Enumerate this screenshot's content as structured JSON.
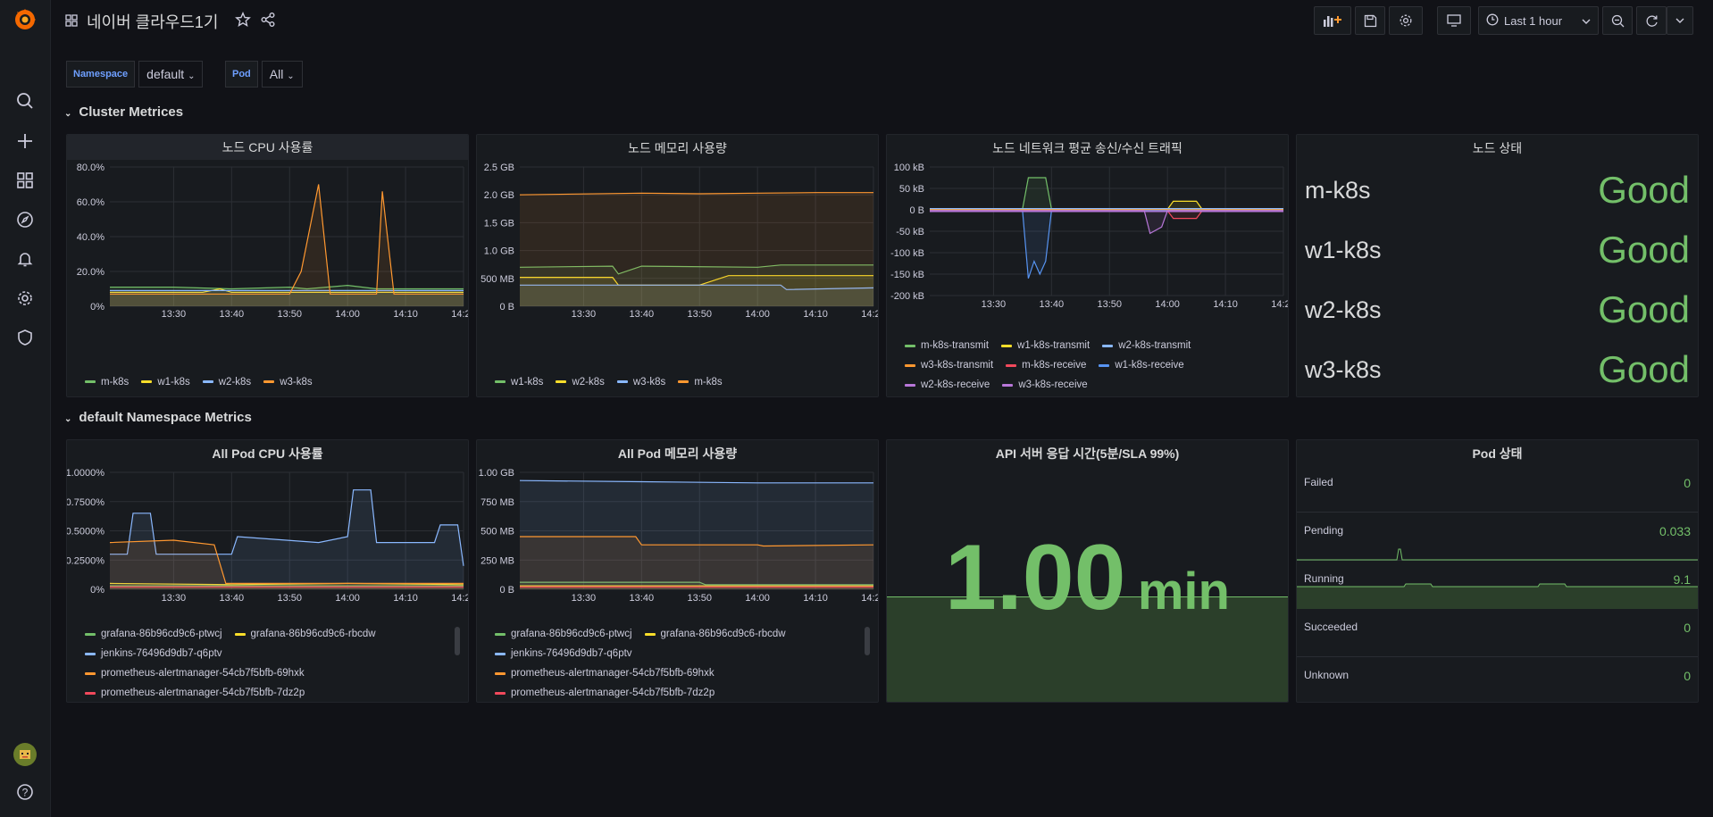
{
  "dashboard": {
    "title": "네이버 클라우드1기"
  },
  "toolbar": {
    "time_range": "Last 1 hour"
  },
  "variables": [
    {
      "label": "Namespace",
      "value": "default"
    },
    {
      "label": "Pod",
      "value": "All"
    }
  ],
  "rows": {
    "cluster": "Cluster Metrices",
    "namespace": "default Namespace Metrics"
  },
  "panels": {
    "node_cpu": {
      "title": "노드 CPU 사용률",
      "legend": [
        "m-k8s",
        "w1-k8s",
        "w2-k8s",
        "w3-k8s"
      ]
    },
    "node_mem": {
      "title": "노드 메모리 사용량",
      "legend": [
        "w1-k8s",
        "w2-k8s",
        "w3-k8s",
        "m-k8s"
      ]
    },
    "node_net": {
      "title": "노드 네트워크 평균 송신/수신 트래픽",
      "legend": [
        "m-k8s-transmit",
        "w1-k8s-transmit",
        "w2-k8s-transmit",
        "w3-k8s-transmit",
        "m-k8s-receive",
        "w1-k8s-receive",
        "w2-k8s-receive",
        "w3-k8s-receive"
      ]
    },
    "node_status": {
      "title": "노드 상태",
      "items": [
        {
          "name": "m-k8s",
          "value": "Good"
        },
        {
          "name": "w1-k8s",
          "value": "Good"
        },
        {
          "name": "w2-k8s",
          "value": "Good"
        },
        {
          "name": "w3-k8s",
          "value": "Good"
        }
      ]
    },
    "pod_cpu": {
      "title": "All Pod CPU 사용률",
      "legend": [
        "grafana-86b96cd9c6-ptwcj",
        "grafana-86b96cd9c6-rbcdw",
        "jenkins-76496d9db7-q6ptv",
        "prometheus-alertmanager-54cb7f5bfb-69hxk",
        "prometheus-alertmanager-54cb7f5bfb-7dz2p"
      ]
    },
    "pod_mem": {
      "title": "All Pod 메모리 사용량",
      "legend": [
        "grafana-86b96cd9c6-ptwcj",
        "grafana-86b96cd9c6-rbcdw",
        "jenkins-76496d9db7-q6ptv",
        "prometheus-alertmanager-54cb7f5bfb-69hxk",
        "prometheus-alertmanager-54cb7f5bfb-7dz2p"
      ]
    },
    "api_resp": {
      "title": "API 서버 응답 시간(5분/SLA 99%)",
      "value": "1.00",
      "unit": "min"
    },
    "pod_status": {
      "title": "Pod 상태",
      "items": [
        {
          "name": "Failed",
          "value": "0"
        },
        {
          "name": "Pending",
          "value": "0.033"
        },
        {
          "name": "Running",
          "value": "9.1"
        },
        {
          "name": "Succeeded",
          "value": "0"
        },
        {
          "name": "Unknown",
          "value": "0"
        }
      ]
    }
  },
  "colors": {
    "green": "#73bf69",
    "yellow": "#fade2a",
    "blue": "#5794f2",
    "orange": "#ff9830",
    "red": "#f2495c",
    "purple": "#b877d9",
    "cyan": "#8ab8ff",
    "teal": "#6ed0e0",
    "lightorange": "#ef843c",
    "pink": "#e24d42"
  },
  "chart_data": [
    {
      "type": "line",
      "panel": "node_cpu",
      "x_ticks": [
        "13:30",
        "13:40",
        "13:50",
        "14:00",
        "14:10",
        "14:20"
      ],
      "y_ticks": [
        "0%",
        "20.0%",
        "40.0%",
        "60.0%",
        "80.0%"
      ],
      "ylim": [
        0,
        80
      ],
      "series": [
        {
          "name": "m-k8s",
          "x": [
            "13:19",
            "13:30",
            "13:40",
            "13:50",
            "13:53",
            "14:00",
            "14:05",
            "14:08",
            "14:20"
          ],
          "y": [
            11,
            11,
            10,
            11,
            10,
            12,
            10,
            10,
            10
          ]
        },
        {
          "name": "w1-k8s",
          "x": [
            "13:19",
            "13:35",
            "13:38",
            "13:40",
            "13:50",
            "14:00",
            "14:10",
            "14:20"
          ],
          "y": [
            8,
            8,
            10,
            8,
            8,
            8,
            8,
            8
          ]
        },
        {
          "name": "w2-k8s",
          "x": [
            "13:19",
            "13:40",
            "13:50",
            "14:00",
            "14:10",
            "14:20"
          ],
          "y": [
            9,
            9,
            9,
            9,
            9,
            9
          ]
        },
        {
          "name": "w3-k8s",
          "x": [
            "13:19",
            "13:50",
            "13:52",
            "13:55",
            "13:57",
            "14:05",
            "14:06",
            "14:08",
            "14:20"
          ],
          "y": [
            7,
            7,
            20,
            70,
            7,
            7,
            66,
            7,
            7
          ]
        }
      ]
    },
    {
      "type": "line",
      "panel": "node_mem",
      "x_ticks": [
        "13:30",
        "13:40",
        "13:50",
        "14:00",
        "14:10",
        "14:20"
      ],
      "y_ticks": [
        "0 B",
        "500 MB",
        "1.0 GB",
        "1.5 GB",
        "2.0 GB",
        "2.5 GB"
      ],
      "ylim": [
        0,
        2.5
      ],
      "series": [
        {
          "name": "w1-k8s",
          "x": [
            "13:19",
            "13:35",
            "13:36",
            "13:40",
            "14:00",
            "14:04",
            "14:20"
          ],
          "y": [
            0.7,
            0.72,
            0.58,
            0.72,
            0.7,
            0.74,
            0.74
          ]
        },
        {
          "name": "w2-k8s",
          "x": [
            "13:19",
            "13:35",
            "13:36",
            "13:50",
            "13:55",
            "14:20"
          ],
          "y": [
            0.52,
            0.52,
            0.38,
            0.38,
            0.55,
            0.55
          ]
        },
        {
          "name": "w3-k8s",
          "x": [
            "13:19",
            "13:40",
            "14:04",
            "14:05",
            "14:20"
          ],
          "y": [
            0.38,
            0.38,
            0.38,
            0.3,
            0.33
          ]
        },
        {
          "name": "m-k8s",
          "x": [
            "13:19",
            "13:40",
            "13:50",
            "14:00",
            "14:10",
            "14:20"
          ],
          "y": [
            2.0,
            2.03,
            2.02,
            2.03,
            2.04,
            2.04
          ]
        }
      ]
    },
    {
      "type": "line",
      "panel": "node_net",
      "x_ticks": [
        "13:30",
        "13:40",
        "13:50",
        "14:00",
        "14:10",
        "14:20"
      ],
      "y_ticks": [
        "-200 kB",
        "-150 kB",
        "-100 kB",
        "-50 kB",
        "0 B",
        "50 kB",
        "100 kB"
      ],
      "ylim": [
        -200,
        100
      ],
      "series": [
        {
          "name": "m-k8s-transmit",
          "x": [
            "13:19",
            "13:35",
            "13:36",
            "13:39",
            "13:40",
            "14:20"
          ],
          "y": [
            2,
            2,
            75,
            75,
            2,
            2
          ]
        },
        {
          "name": "w1-k8s-transmit",
          "x": [
            "13:19",
            "14:00",
            "14:01",
            "14:05",
            "14:06",
            "14:20"
          ],
          "y": [
            1,
            1,
            20,
            20,
            1,
            1
          ]
        },
        {
          "name": "w2-k8s-transmit",
          "x": [
            "13:19",
            "14:20"
          ],
          "y": [
            3,
            3
          ]
        },
        {
          "name": "w3-k8s-transmit",
          "x": [
            "13:19",
            "14:20"
          ],
          "y": [
            0,
            0
          ]
        },
        {
          "name": "m-k8s-receive",
          "x": [
            "13:19",
            "13:36",
            "13:40",
            "14:00",
            "14:01",
            "14:05",
            "14:06",
            "14:20"
          ],
          "y": [
            -2,
            -2,
            -2,
            -2,
            -20,
            -20,
            -2,
            -2
          ]
        },
        {
          "name": "w1-k8s-receive",
          "x": [
            "13:19",
            "13:35",
            "13:36",
            "13:37",
            "13:38",
            "13:39",
            "13:40",
            "14:20"
          ],
          "y": [
            -2,
            -2,
            -160,
            -120,
            -150,
            -120,
            -2,
            -2
          ]
        },
        {
          "name": "w2-k8s-receive",
          "x": [
            "13:19",
            "13:56",
            "13:57",
            "13:59",
            "14:00",
            "14:20"
          ],
          "y": [
            -2,
            -2,
            -55,
            -40,
            -2,
            -2
          ]
        },
        {
          "name": "w3-k8s-receive",
          "x": [
            "13:19",
            "14:20"
          ],
          "y": [
            -4,
            -4
          ]
        }
      ]
    },
    {
      "type": "line",
      "panel": "pod_cpu",
      "x_ticks": [
        "13:30",
        "13:40",
        "13:50",
        "14:00",
        "14:10",
        "14:20"
      ],
      "y_ticks": [
        "0%",
        "0.2500%",
        "0.5000%",
        "0.7500%",
        "1.0000%"
      ],
      "ylim": [
        0,
        1.0
      ],
      "series": [
        {
          "name": "grafana-86b96cd9c6-ptwcj",
          "x": [
            "13:19",
            "13:40",
            "14:00",
            "14:20"
          ],
          "y": [
            0.03,
            0.03,
            0.03,
            0.03
          ]
        },
        {
          "name": "grafana-86b96cd9c6-rbcdw",
          "x": [
            "13:19",
            "13:40",
            "14:00",
            "14:20"
          ],
          "y": [
            0.05,
            0.04,
            0.05,
            0.04
          ]
        },
        {
          "name": "jenkins-76496d9db7-q6ptv",
          "x": [
            "13:19",
            "13:22",
            "13:23",
            "13:26",
            "13:27",
            "13:40",
            "13:41",
            "13:55",
            "14:00",
            "14:01",
            "14:04",
            "14:05",
            "14:15",
            "14:16",
            "14:19",
            "14:20"
          ],
          "y": [
            0.3,
            0.3,
            0.65,
            0.65,
            0.3,
            0.3,
            0.45,
            0.4,
            0.45,
            0.85,
            0.85,
            0.4,
            0.4,
            0.55,
            0.55,
            0.2
          ]
        },
        {
          "name": "prometheus-alertmanager-54cb7f5bfb-69hxk",
          "x": [
            "13:19",
            "13:30",
            "13:37",
            "13:39",
            "14:20"
          ],
          "y": [
            0.4,
            0.42,
            0.38,
            0.05,
            0.05
          ]
        },
        {
          "name": "prometheus-alertmanager-54cb7f5bfb-7dz2p",
          "x": [
            "13:19",
            "14:20"
          ],
          "y": [
            0.02,
            0.02
          ]
        }
      ]
    },
    {
      "type": "line",
      "panel": "pod_mem",
      "x_ticks": [
        "13:30",
        "13:40",
        "13:50",
        "14:00",
        "14:10",
        "14:20"
      ],
      "y_ticks": [
        "0 B",
        "250 MB",
        "500 MB",
        "750 MB",
        "1.00 GB"
      ],
      "ylim": [
        0,
        1000
      ],
      "series": [
        {
          "name": "grafana-86b96cd9c6-ptwcj",
          "x": [
            "13:19",
            "13:50",
            "13:51",
            "14:20"
          ],
          "y": [
            60,
            60,
            40,
            40
          ]
        },
        {
          "name": "grafana-86b96cd9c6-rbcdw",
          "x": [
            "13:19",
            "14:20"
          ],
          "y": [
            30,
            30
          ]
        },
        {
          "name": "jenkins-76496d9db7-q6ptv",
          "x": [
            "13:19",
            "13:40",
            "14:00",
            "14:20"
          ],
          "y": [
            930,
            920,
            910,
            910
          ]
        },
        {
          "name": "prometheus-alertmanager-54cb7f5bfb-69hxk",
          "x": [
            "13:19",
            "13:39",
            "13:40",
            "14:00",
            "14:01",
            "14:20"
          ],
          "y": [
            450,
            450,
            380,
            380,
            370,
            380
          ]
        },
        {
          "name": "prometheus-alertmanager-54cb7f5bfb-7dz2p",
          "x": [
            "13:19",
            "14:20"
          ],
          "y": [
            20,
            20
          ]
        }
      ]
    }
  ]
}
